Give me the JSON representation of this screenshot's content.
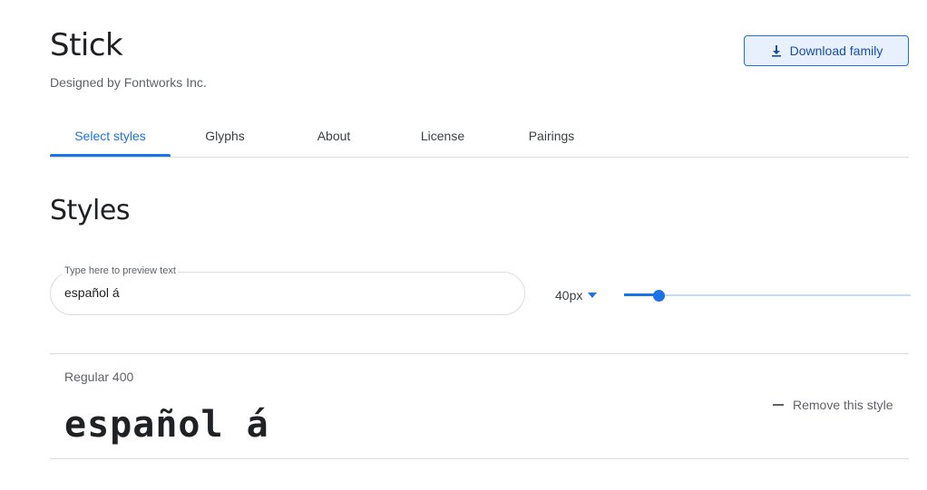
{
  "font": {
    "name": "Stick",
    "designer": "Designed by Fontworks Inc."
  },
  "download_button": {
    "label": "Download family",
    "icon": "download-icon"
  },
  "tabs": [
    {
      "label": "Select styles",
      "active": true
    },
    {
      "label": "Glyphs",
      "active": false
    },
    {
      "label": "About",
      "active": false
    },
    {
      "label": "License",
      "active": false
    },
    {
      "label": "Pairings",
      "active": false
    }
  ],
  "styles_section": {
    "heading": "Styles",
    "preview_label": "Type here to preview text",
    "preview_value": "español á",
    "size_value": "40px",
    "slider_fraction": 0.12
  },
  "style_rows": [
    {
      "name": "Regular 400",
      "preview": "español á",
      "remove_label": "Remove this style"
    }
  ],
  "colors": {
    "accent": "#1a73e8",
    "button_bg": "#e8f0fe",
    "divider": "#dadce0"
  }
}
